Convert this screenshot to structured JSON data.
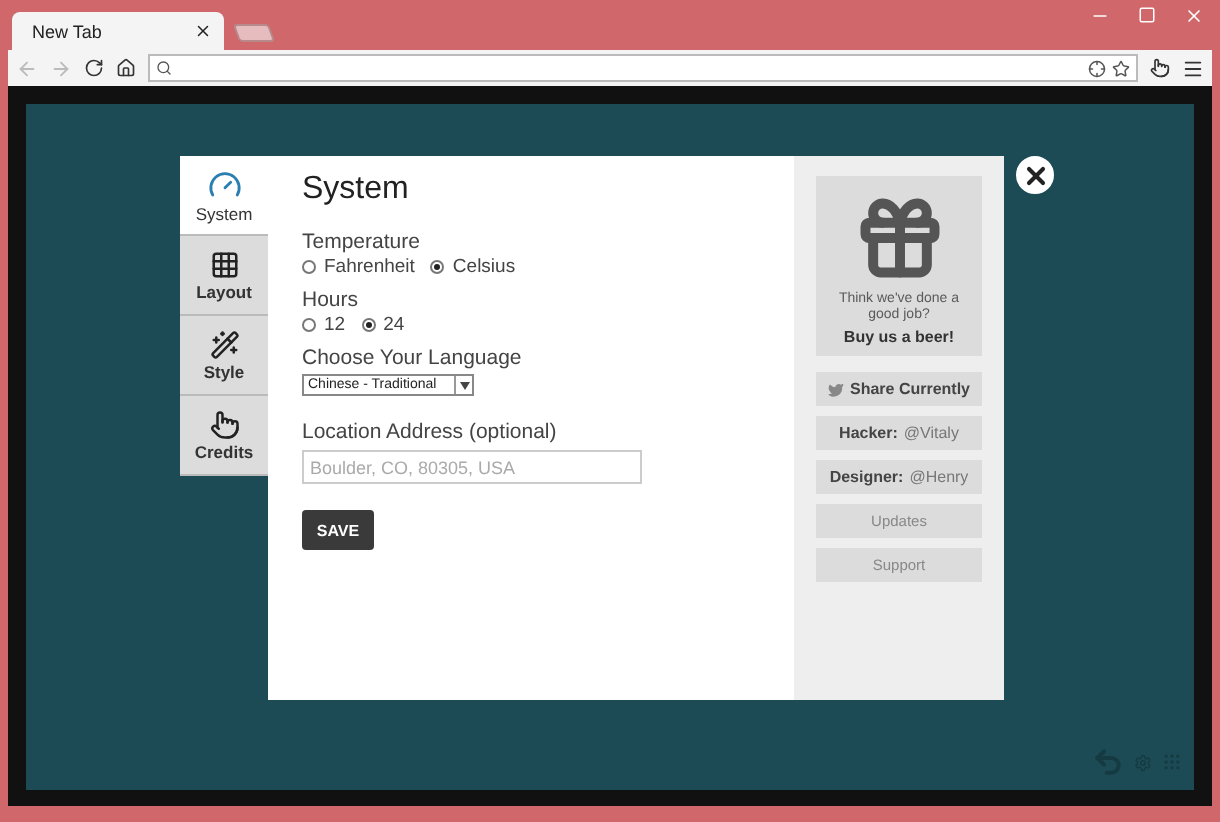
{
  "browser": {
    "tabs": [
      {
        "title": "New Tab",
        "selected": true
      }
    ]
  },
  "settings_nav": {
    "items": [
      {
        "kind": "gauge",
        "label": "System",
        "selected": true
      },
      {
        "kind": "grid",
        "label": "Layout",
        "selected": false
      },
      {
        "kind": "wand",
        "label": "Style",
        "selected": false
      },
      {
        "kind": "hand",
        "label": "Credits",
        "selected": false
      }
    ]
  },
  "panel": {
    "title": "System",
    "temperature": {
      "label": "Temperature",
      "options": [
        {
          "label": "Fahrenheit",
          "selected": false
        },
        {
          "label": "Celsius",
          "selected": true
        }
      ]
    },
    "hours": {
      "label": "Hours",
      "options": [
        {
          "label": "12",
          "selected": false
        },
        {
          "label": "24",
          "selected": true
        }
      ]
    },
    "language": {
      "label": "Choose Your Language",
      "value": "Chinese - Traditional"
    },
    "location": {
      "label": "Location Address (optional)",
      "placeholder": "Boulder, CO, 80305, USA"
    },
    "save": "SAVE"
  },
  "sidebar": {
    "donate": {
      "text": "Think we've done a good job?",
      "cta": "Buy us a beer!"
    },
    "buttons": [
      {
        "kind": "share",
        "label": "Share Currently"
      },
      {
        "kind": "credit",
        "role": "Hacker:",
        "handle": "@Vitaly"
      },
      {
        "kind": "credit",
        "role": "Designer:",
        "handle": "@Henry"
      },
      {
        "kind": "plain",
        "label": "Updates"
      },
      {
        "kind": "plain",
        "label": "Support"
      }
    ]
  }
}
